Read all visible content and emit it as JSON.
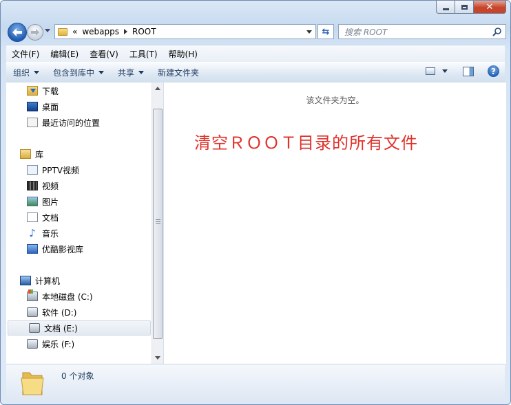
{
  "address": {
    "overflow": "«",
    "crumbs": [
      "webapps",
      "ROOT"
    ]
  },
  "search": {
    "placeholder": "搜索 ROOT"
  },
  "menu": [
    "文件(F)",
    "编辑(E)",
    "查看(V)",
    "工具(T)",
    "帮助(H)"
  ],
  "toolbar": {
    "organize": "组织",
    "include_library": "包含到库中",
    "share": "共享",
    "new_folder": "新建文件夹"
  },
  "nav": {
    "favorites": [
      {
        "label": "下载",
        "icon": "download-folder-icon"
      },
      {
        "label": "桌面",
        "icon": "desktop-icon"
      },
      {
        "label": "最近访问的位置",
        "icon": "recent-places-icon"
      }
    ],
    "libraries_label": "库",
    "libraries": [
      {
        "label": "PPTV视频",
        "icon": "pptv-library-icon"
      },
      {
        "label": "视频",
        "icon": "video-library-icon"
      },
      {
        "label": "图片",
        "icon": "picture-library-icon"
      },
      {
        "label": "文档",
        "icon": "document-library-icon"
      },
      {
        "label": "音乐",
        "icon": "music-library-icon"
      },
      {
        "label": "优酷影视库",
        "icon": "youku-library-icon"
      }
    ],
    "computer_label": "计算机",
    "drives": [
      {
        "label": "本地磁盘 (C:)",
        "icon": "system-drive-icon"
      },
      {
        "label": "软件 (D:)",
        "icon": "drive-icon"
      },
      {
        "label": "文档 (E:)",
        "icon": "drive-icon"
      },
      {
        "label": "娱乐 (F:)",
        "icon": "drive-icon"
      }
    ]
  },
  "content": {
    "empty_message": "该文件夹为空。",
    "annotation": "清空ＲＯＯＴ目录的所有文件",
    "annotation_color": "#e0322b"
  },
  "status": {
    "text": "0 个对象"
  }
}
